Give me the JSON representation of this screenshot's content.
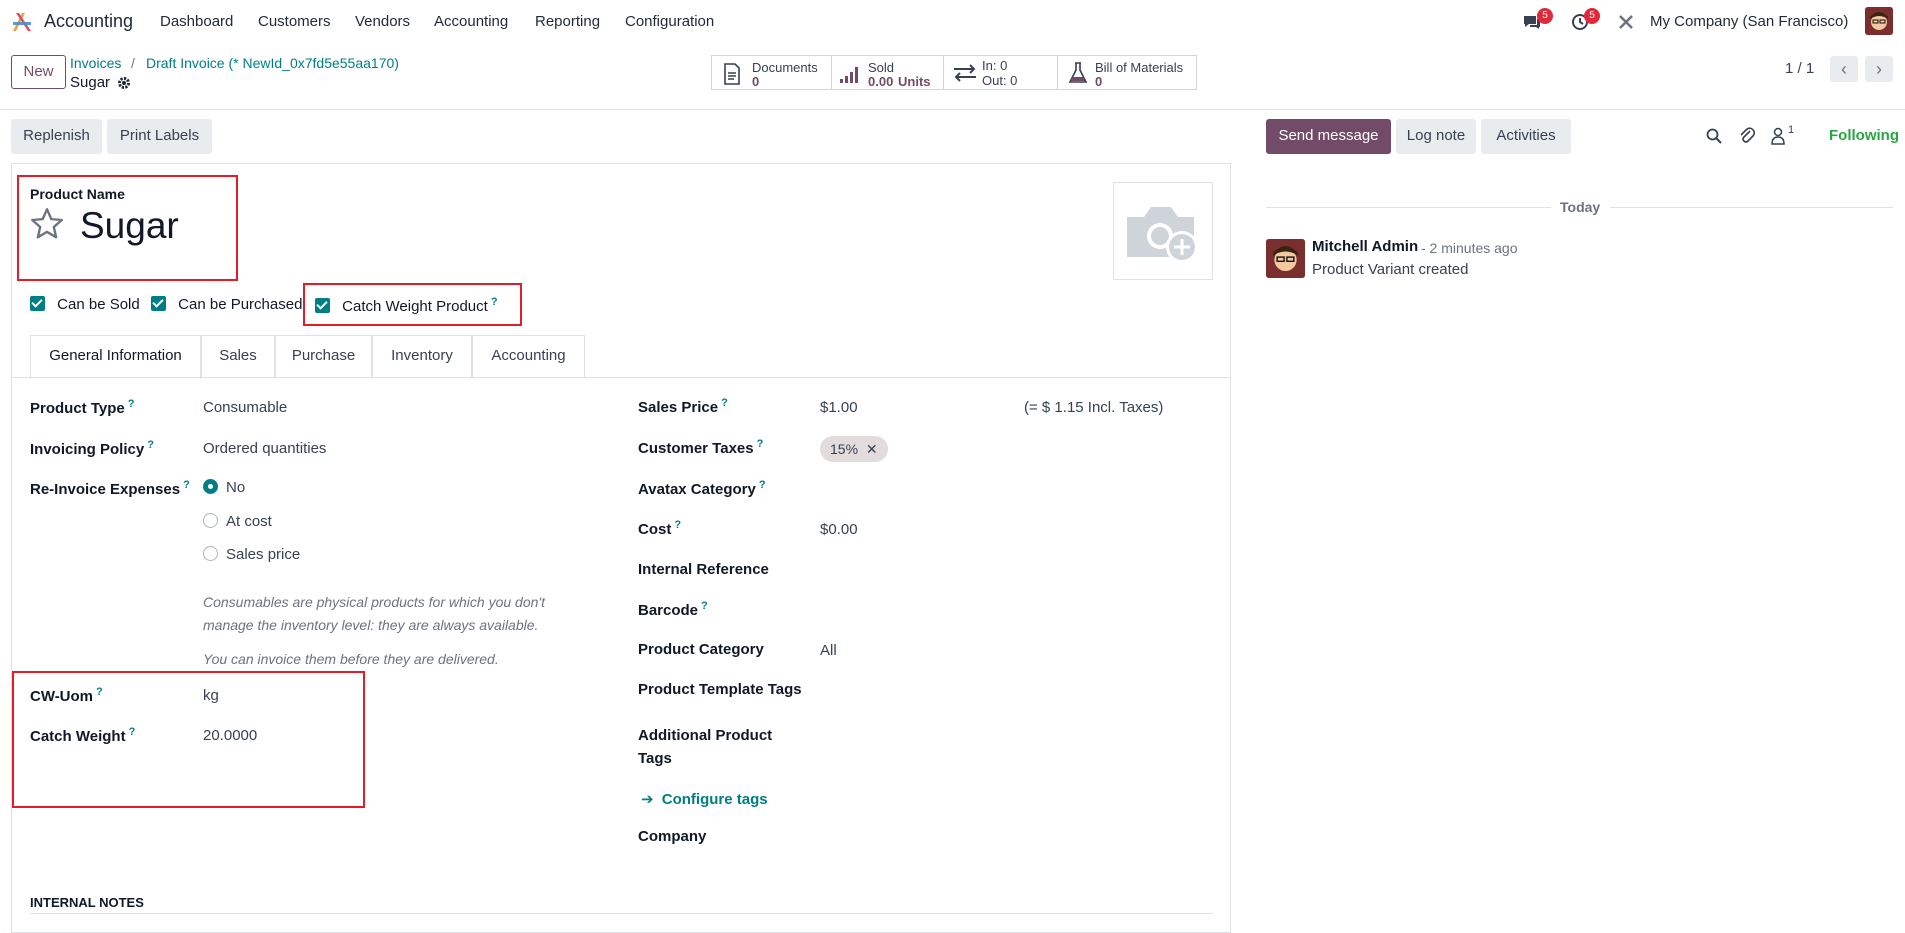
{
  "app": {
    "name": "Accounting"
  },
  "topnav": {
    "menus": [
      "Dashboard",
      "Customers",
      "Vendors",
      "Accounting",
      "Reporting",
      "Configuration"
    ],
    "messages_count": "5",
    "activities_count": "5",
    "company": "My Company (San Francisco)"
  },
  "breadcrumb": {
    "new_label": "New",
    "items": [
      "Invoices",
      "Draft Invoice (* NewId_0x7fd5e55aa170)"
    ],
    "separator": "/",
    "current": "Sugar"
  },
  "stats": {
    "documents": {
      "label": "Documents",
      "value": "0"
    },
    "sold": {
      "label": "Sold",
      "value": "0.00",
      "unit": "Units"
    },
    "moves": {
      "in": "In: 0",
      "out": "Out: 0"
    },
    "bom": {
      "label": "Bill of Materials",
      "value": "0"
    }
  },
  "pager": {
    "text": "1 / 1"
  },
  "actions": {
    "replenish": "Replenish",
    "print_labels": "Print Labels"
  },
  "chatter": {
    "send_message": "Send message",
    "log_note": "Log note",
    "activities": "Activities",
    "followers_count": "1",
    "following": "Following",
    "date_separator": "Today",
    "message": {
      "author": "Mitchell Admin",
      "time": "- 2 minutes ago",
      "body": "Product Variant created"
    }
  },
  "form": {
    "product_name_label": "Product Name",
    "product_name": "Sugar",
    "checkboxes": {
      "can_be_sold": "Can be Sold",
      "can_be_purchased": "Can be Purchased",
      "catch_weight": "Catch Weight Product"
    },
    "help_mark": "?",
    "tabs": [
      "General Information",
      "Sales",
      "Purchase",
      "Inventory",
      "Accounting"
    ],
    "left": {
      "product_type": {
        "label": "Product Type",
        "value": "Consumable"
      },
      "invoicing_policy": {
        "label": "Invoicing Policy",
        "value": "Ordered quantities"
      },
      "reinvoice": {
        "label": "Re-Invoice Expenses",
        "options": [
          "No",
          "At cost",
          "Sales price"
        ],
        "selected": "No"
      },
      "note1": "Consumables are physical products for which you don't manage the inventory level: they are always available.",
      "note2": "You can invoice them before they are delivered.",
      "cw_uom": {
        "label": "CW-Uom",
        "value": "kg"
      },
      "catch_weight": {
        "label": "Catch Weight",
        "value": "20.0000"
      }
    },
    "right": {
      "sales_price": {
        "label": "Sales Price",
        "value": "$1.00",
        "incl": "(= $ 1.15 Incl. Taxes)"
      },
      "customer_taxes": {
        "label": "Customer Taxes",
        "tag": "15%"
      },
      "avatax_category": {
        "label": "Avatax Category"
      },
      "cost": {
        "label": "Cost",
        "value": "$0.00"
      },
      "internal_reference": {
        "label": "Internal Reference"
      },
      "barcode": {
        "label": "Barcode"
      },
      "product_category": {
        "label": "Product Category",
        "value": "All"
      },
      "template_tags": {
        "label": "Product Template Tags"
      },
      "additional_tags": {
        "label_line1": "Additional Product",
        "label_line2": "Tags"
      },
      "configure_tags": "Configure tags",
      "company": {
        "label": "Company"
      }
    },
    "internal_notes": "INTERNAL NOTES"
  }
}
